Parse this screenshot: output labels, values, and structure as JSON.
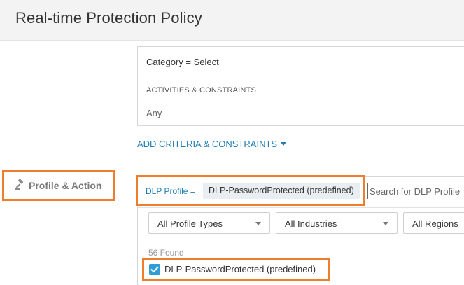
{
  "header": {
    "title": "Real-time Protection Policy"
  },
  "criteria": {
    "category_row": "Category = Select",
    "activities_title": "ACTIVITIES & CONSTRAINTS",
    "activities_value": "Any",
    "add_link": "ADD CRITERIA & CONSTRAINTS"
  },
  "section": {
    "label": "Profile & Action",
    "icon": "gavel-icon"
  },
  "dlp": {
    "label": "DLP Profile =",
    "selected": "DLP-PasswordProtected (predefined)",
    "search_placeholder": "Search for DLP Profile"
  },
  "filters": {
    "profile_types": "All Profile Types",
    "industries": "All Industries",
    "regions": "All Regions"
  },
  "results": {
    "count_text": "56 Found",
    "items": [
      {
        "label": "DLP-PasswordProtected (predefined)",
        "checked": true
      }
    ]
  },
  "colors": {
    "accent_blue": "#1f7fb5",
    "highlight_orange": "#f07d2b",
    "checkbox_blue": "#2f9dd6"
  }
}
